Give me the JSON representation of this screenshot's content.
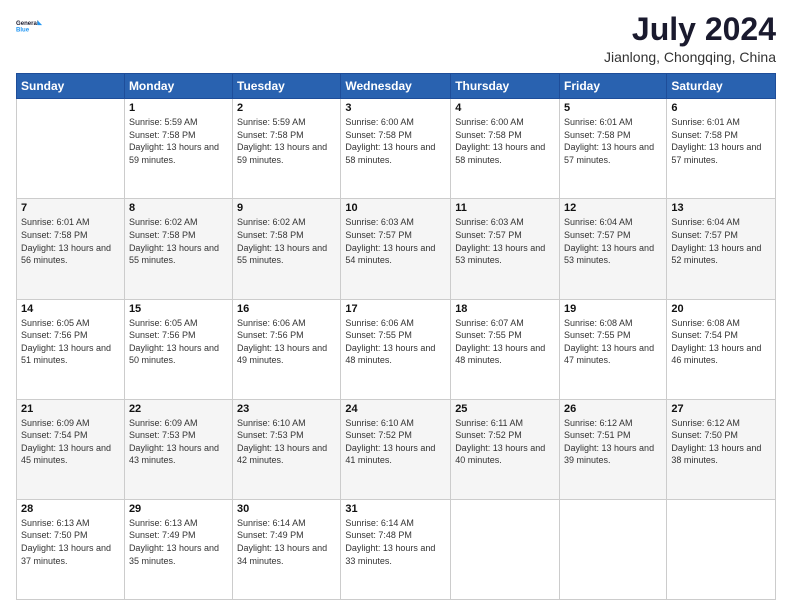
{
  "header": {
    "logo_line1": "General",
    "logo_line2": "Blue",
    "month_title": "July 2024",
    "location": "Jianlong, Chongqing, China"
  },
  "weekdays": [
    "Sunday",
    "Monday",
    "Tuesday",
    "Wednesday",
    "Thursday",
    "Friday",
    "Saturday"
  ],
  "weeks": [
    [
      {
        "day": "",
        "sunrise": "",
        "sunset": "",
        "daylight": ""
      },
      {
        "day": "1",
        "sunrise": "Sunrise: 5:59 AM",
        "sunset": "Sunset: 7:58 PM",
        "daylight": "Daylight: 13 hours and 59 minutes."
      },
      {
        "day": "2",
        "sunrise": "Sunrise: 5:59 AM",
        "sunset": "Sunset: 7:58 PM",
        "daylight": "Daylight: 13 hours and 59 minutes."
      },
      {
        "day": "3",
        "sunrise": "Sunrise: 6:00 AM",
        "sunset": "Sunset: 7:58 PM",
        "daylight": "Daylight: 13 hours and 58 minutes."
      },
      {
        "day": "4",
        "sunrise": "Sunrise: 6:00 AM",
        "sunset": "Sunset: 7:58 PM",
        "daylight": "Daylight: 13 hours and 58 minutes."
      },
      {
        "day": "5",
        "sunrise": "Sunrise: 6:01 AM",
        "sunset": "Sunset: 7:58 PM",
        "daylight": "Daylight: 13 hours and 57 minutes."
      },
      {
        "day": "6",
        "sunrise": "Sunrise: 6:01 AM",
        "sunset": "Sunset: 7:58 PM",
        "daylight": "Daylight: 13 hours and 57 minutes."
      }
    ],
    [
      {
        "day": "7",
        "sunrise": "Sunrise: 6:01 AM",
        "sunset": "Sunset: 7:58 PM",
        "daylight": "Daylight: 13 hours and 56 minutes."
      },
      {
        "day": "8",
        "sunrise": "Sunrise: 6:02 AM",
        "sunset": "Sunset: 7:58 PM",
        "daylight": "Daylight: 13 hours and 55 minutes."
      },
      {
        "day": "9",
        "sunrise": "Sunrise: 6:02 AM",
        "sunset": "Sunset: 7:58 PM",
        "daylight": "Daylight: 13 hours and 55 minutes."
      },
      {
        "day": "10",
        "sunrise": "Sunrise: 6:03 AM",
        "sunset": "Sunset: 7:57 PM",
        "daylight": "Daylight: 13 hours and 54 minutes."
      },
      {
        "day": "11",
        "sunrise": "Sunrise: 6:03 AM",
        "sunset": "Sunset: 7:57 PM",
        "daylight": "Daylight: 13 hours and 53 minutes."
      },
      {
        "day": "12",
        "sunrise": "Sunrise: 6:04 AM",
        "sunset": "Sunset: 7:57 PM",
        "daylight": "Daylight: 13 hours and 53 minutes."
      },
      {
        "day": "13",
        "sunrise": "Sunrise: 6:04 AM",
        "sunset": "Sunset: 7:57 PM",
        "daylight": "Daylight: 13 hours and 52 minutes."
      }
    ],
    [
      {
        "day": "14",
        "sunrise": "Sunrise: 6:05 AM",
        "sunset": "Sunset: 7:56 PM",
        "daylight": "Daylight: 13 hours and 51 minutes."
      },
      {
        "day": "15",
        "sunrise": "Sunrise: 6:05 AM",
        "sunset": "Sunset: 7:56 PM",
        "daylight": "Daylight: 13 hours and 50 minutes."
      },
      {
        "day": "16",
        "sunrise": "Sunrise: 6:06 AM",
        "sunset": "Sunset: 7:56 PM",
        "daylight": "Daylight: 13 hours and 49 minutes."
      },
      {
        "day": "17",
        "sunrise": "Sunrise: 6:06 AM",
        "sunset": "Sunset: 7:55 PM",
        "daylight": "Daylight: 13 hours and 48 minutes."
      },
      {
        "day": "18",
        "sunrise": "Sunrise: 6:07 AM",
        "sunset": "Sunset: 7:55 PM",
        "daylight": "Daylight: 13 hours and 48 minutes."
      },
      {
        "day": "19",
        "sunrise": "Sunrise: 6:08 AM",
        "sunset": "Sunset: 7:55 PM",
        "daylight": "Daylight: 13 hours and 47 minutes."
      },
      {
        "day": "20",
        "sunrise": "Sunrise: 6:08 AM",
        "sunset": "Sunset: 7:54 PM",
        "daylight": "Daylight: 13 hours and 46 minutes."
      }
    ],
    [
      {
        "day": "21",
        "sunrise": "Sunrise: 6:09 AM",
        "sunset": "Sunset: 7:54 PM",
        "daylight": "Daylight: 13 hours and 45 minutes."
      },
      {
        "day": "22",
        "sunrise": "Sunrise: 6:09 AM",
        "sunset": "Sunset: 7:53 PM",
        "daylight": "Daylight: 13 hours and 43 minutes."
      },
      {
        "day": "23",
        "sunrise": "Sunrise: 6:10 AM",
        "sunset": "Sunset: 7:53 PM",
        "daylight": "Daylight: 13 hours and 42 minutes."
      },
      {
        "day": "24",
        "sunrise": "Sunrise: 6:10 AM",
        "sunset": "Sunset: 7:52 PM",
        "daylight": "Daylight: 13 hours and 41 minutes."
      },
      {
        "day": "25",
        "sunrise": "Sunrise: 6:11 AM",
        "sunset": "Sunset: 7:52 PM",
        "daylight": "Daylight: 13 hours and 40 minutes."
      },
      {
        "day": "26",
        "sunrise": "Sunrise: 6:12 AM",
        "sunset": "Sunset: 7:51 PM",
        "daylight": "Daylight: 13 hours and 39 minutes."
      },
      {
        "day": "27",
        "sunrise": "Sunrise: 6:12 AM",
        "sunset": "Sunset: 7:50 PM",
        "daylight": "Daylight: 13 hours and 38 minutes."
      }
    ],
    [
      {
        "day": "28",
        "sunrise": "Sunrise: 6:13 AM",
        "sunset": "Sunset: 7:50 PM",
        "daylight": "Daylight: 13 hours and 37 minutes."
      },
      {
        "day": "29",
        "sunrise": "Sunrise: 6:13 AM",
        "sunset": "Sunset: 7:49 PM",
        "daylight": "Daylight: 13 hours and 35 minutes."
      },
      {
        "day": "30",
        "sunrise": "Sunrise: 6:14 AM",
        "sunset": "Sunset: 7:49 PM",
        "daylight": "Daylight: 13 hours and 34 minutes."
      },
      {
        "day": "31",
        "sunrise": "Sunrise: 6:14 AM",
        "sunset": "Sunset: 7:48 PM",
        "daylight": "Daylight: 13 hours and 33 minutes."
      },
      {
        "day": "",
        "sunrise": "",
        "sunset": "",
        "daylight": ""
      },
      {
        "day": "",
        "sunrise": "",
        "sunset": "",
        "daylight": ""
      },
      {
        "day": "",
        "sunrise": "",
        "sunset": "",
        "daylight": ""
      }
    ]
  ]
}
